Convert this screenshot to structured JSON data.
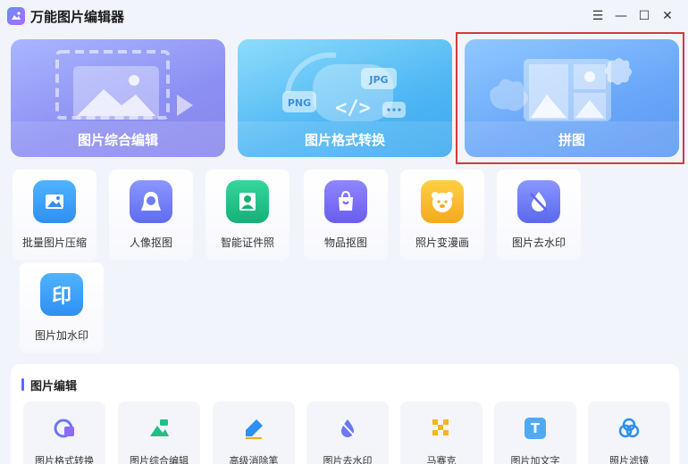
{
  "app": {
    "title": "万能图片编辑器"
  },
  "window_controls": {
    "menu": "☰",
    "minimize": "—",
    "maximize": "☐",
    "close": "✕"
  },
  "feature_cards": [
    {
      "label": "图片综合编辑",
      "icon": "image-edit-icon"
    },
    {
      "label": "图片格式转换",
      "icon": "format-convert-icon",
      "badges": [
        "PNG",
        "JPG",
        "</>"
      ]
    },
    {
      "label": "拼图",
      "icon": "collage-icon"
    }
  ],
  "tools": [
    {
      "label": "批量图片压缩",
      "icon": "image-compress-icon",
      "color": "#2f9df7"
    },
    {
      "label": "人像抠图",
      "icon": "portrait-cutout-icon",
      "color": "#6f7df5"
    },
    {
      "label": "智能证件照",
      "icon": "id-photo-icon",
      "color": "#1fbf86"
    },
    {
      "label": "物品抠图",
      "icon": "object-cutout-icon",
      "color": "#7a6cf5"
    },
    {
      "label": "照片变漫画",
      "icon": "cartoon-icon",
      "color": "#f7b72b"
    },
    {
      "label": "图片去水印",
      "icon": "remove-watermark-icon",
      "color": "#6a78f2"
    },
    {
      "label": "图片加水印",
      "icon": "add-watermark-icon",
      "color": "#2f9df7",
      "glyph": "印"
    }
  ],
  "image_edit_section": {
    "title": "图片编辑",
    "items": [
      {
        "label": "图片格式转换",
        "icon": "format-convert-small-icon"
      },
      {
        "label": "图片综合编辑",
        "icon": "image-edit-small-icon"
      },
      {
        "label": "高级消除笔",
        "icon": "eraser-pen-icon"
      },
      {
        "label": "图片去水印",
        "icon": "remove-watermark-small-icon"
      },
      {
        "label": "马赛克",
        "icon": "mosaic-icon"
      },
      {
        "label": "图片加文字",
        "icon": "add-text-icon",
        "glyph": "T"
      },
      {
        "label": "照片滤镜",
        "icon": "photo-filter-icon"
      }
    ]
  }
}
